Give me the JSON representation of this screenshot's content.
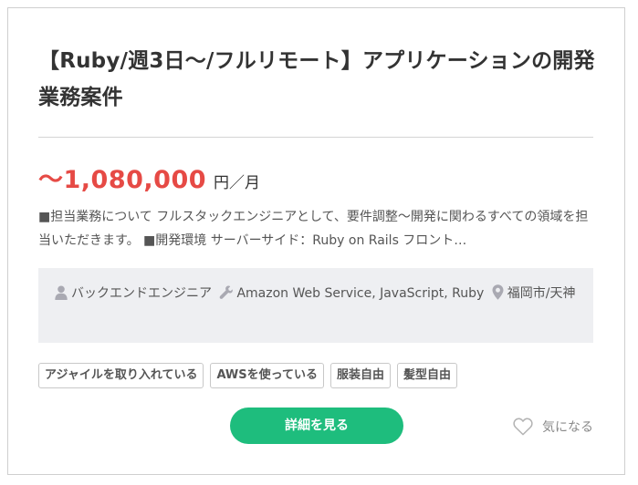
{
  "job": {
    "title": "【Ruby/週3日〜/フルリモート】アプリケーションの開発業務案件",
    "price": {
      "amount": "〜1,080,000",
      "unit": "円／月"
    },
    "description": "■担当業務について フルスタックエンジニアとして、要件調整〜開発に関わるすべての領域を担当いただきます。 ■開発環境 サーバーサイド：Ruby on Rails フロント…",
    "info": {
      "role": "バックエンドエンジニア",
      "skills": "Amazon Web Service, JavaScript, Ruby",
      "location": "福岡市/天神"
    },
    "tags": [
      "アジャイルを取り入れている",
      "AWSを使っている",
      "服装自由",
      "髪型自由"
    ],
    "detail_button": "詳細を見る",
    "favorite_label": "気になる"
  },
  "colors": {
    "price": "#e64a45",
    "button": "#1ebd7d",
    "info_background": "#eeeff2",
    "icon": "#a9a9b2"
  },
  "icons": {
    "role": "person-icon",
    "skills": "wrench-icon",
    "location": "map-pin-icon",
    "favorite": "heart-icon"
  }
}
